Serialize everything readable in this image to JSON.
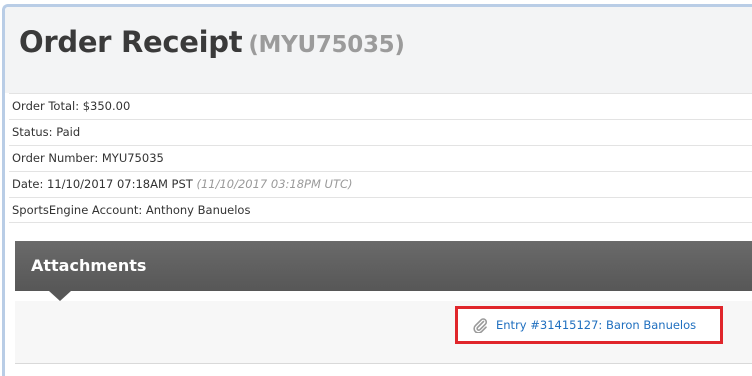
{
  "header": {
    "title": "Order Receipt",
    "order_code": "(MYU75035)"
  },
  "details": [
    {
      "label": "Order Total:",
      "value": "$350.00"
    },
    {
      "label": "Status:",
      "value": "Paid"
    },
    {
      "label": "Order Number:",
      "value": "MYU75035"
    },
    {
      "label": "Date:",
      "value": "11/10/2017 07:18AM PST",
      "extra": "(11/10/2017 03:18PM UTC)"
    },
    {
      "label": "SportsEngine Account:",
      "value": "Anthony Banuelos"
    }
  ],
  "attachments": {
    "heading": "Attachments",
    "link_text": "Entry #31415127: Baron Banuelos",
    "link_icon": "paperclip-icon"
  },
  "colors": {
    "header_bg": "#f3f4f5",
    "bar_bg": "#5f5f5f",
    "link": "#1f6fbf",
    "highlight_border": "#e0262b",
    "frame_border": "#b9cde6"
  }
}
